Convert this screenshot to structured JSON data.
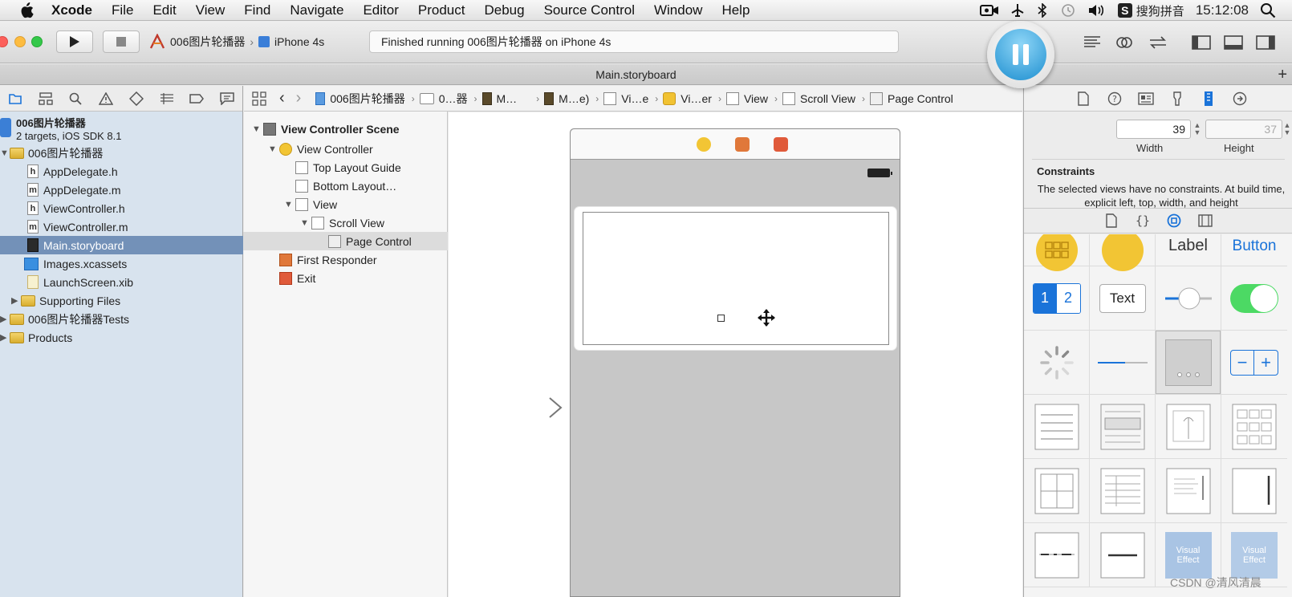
{
  "menubar": {
    "app_name": "Xcode",
    "items": [
      "File",
      "Edit",
      "View",
      "Find",
      "Navigate",
      "Editor",
      "Product",
      "Debug",
      "Source Control",
      "Window",
      "Help"
    ],
    "input_method": "搜狗拼音",
    "input_badge": "S",
    "clock": "15:12:08"
  },
  "toolbar": {
    "scheme": "006图片轮播器",
    "device": "iPhone 4s",
    "status": "Finished running 006图片轮播器 on iPhone 4s"
  },
  "tab": {
    "title": "Main.storyboard"
  },
  "navigator": {
    "project_name": "006图片轮播器",
    "project_sub": "2 targets, iOS SDK 8.1",
    "items": [
      {
        "label": "006图片轮播器",
        "kind": "folder"
      },
      {
        "label": "AppDelegate.h",
        "kind": "h"
      },
      {
        "label": "AppDelegate.m",
        "kind": "m"
      },
      {
        "label": "ViewController.h",
        "kind": "h"
      },
      {
        "label": "ViewController.m",
        "kind": "m"
      },
      {
        "label": "Main.storyboard",
        "kind": "sb"
      },
      {
        "label": "Images.xcassets",
        "kind": "xc"
      },
      {
        "label": "LaunchScreen.xib",
        "kind": "xib"
      },
      {
        "label": "Supporting Files",
        "kind": "folder"
      },
      {
        "label": "006图片轮播器Tests",
        "kind": "folder"
      },
      {
        "label": "Products",
        "kind": "folder"
      }
    ]
  },
  "jumpbar": {
    "items": [
      "006图片轮播器",
      "0…器",
      "M…",
      "M…e)",
      "Vi…e",
      "Vi…er",
      "View",
      "Scroll View",
      "Page Control"
    ]
  },
  "outline": {
    "items": [
      "View Controller Scene",
      "View Controller",
      "Top Layout Guide",
      "Bottom Layout…",
      "View",
      "Scroll View",
      "Page Control",
      "First Responder",
      "Exit"
    ]
  },
  "inspector": {
    "width_value": "39",
    "height_value": "37",
    "width_label": "Width",
    "height_label": "Height",
    "constraints_heading": "Constraints",
    "constraints_text": "The selected views have no constraints. At build time, explicit left, top, width, and height"
  },
  "library": {
    "label_text": "Label",
    "button_text": "Button",
    "segment_1": "1",
    "segment_2": "2",
    "textfield_text": "Text",
    "stepper_minus": "−",
    "stepper_plus": "+",
    "visual_effect": "Visual Effect"
  },
  "watermark": "CSDN @清风清晨"
}
